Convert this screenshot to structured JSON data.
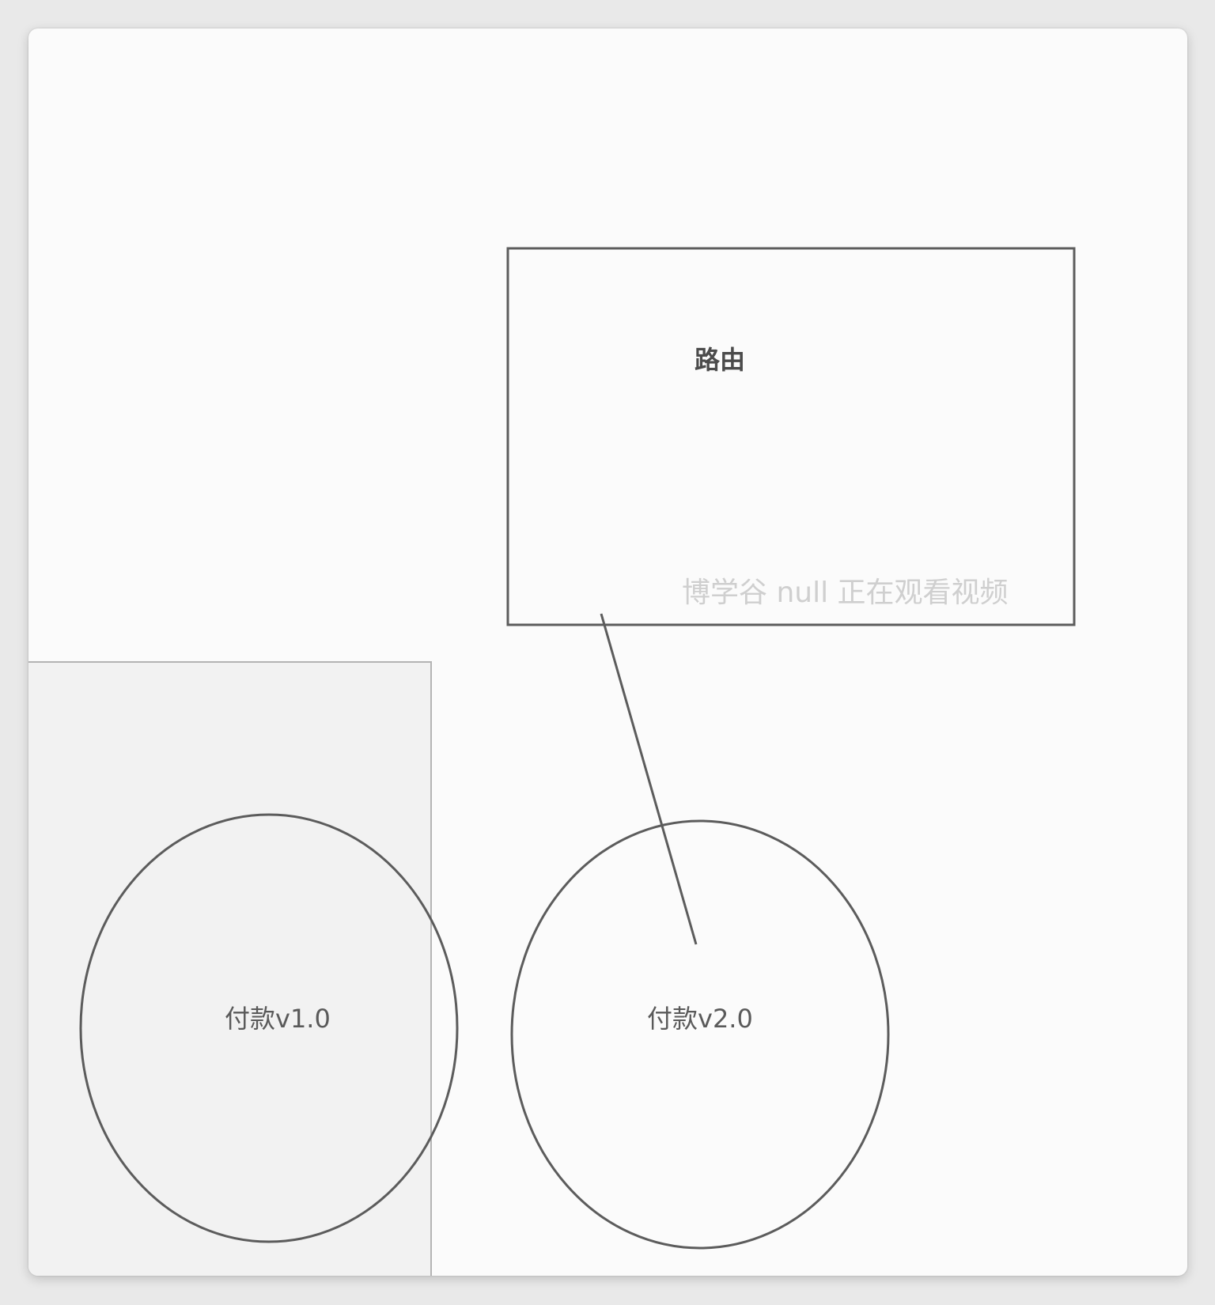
{
  "diagram": {
    "router_label": "路由",
    "watermark": "博学谷 null 正在观看视频",
    "nodes": [
      {
        "label": "付款v1.0"
      },
      {
        "label": "付款v2.0"
      }
    ],
    "edges": [
      {
        "from": "路由",
        "to": "付款v2.0"
      }
    ],
    "colors": {
      "stroke": "#5c5c5c",
      "panel": "#f2f2f2",
      "background": "#fbfbfb"
    }
  }
}
